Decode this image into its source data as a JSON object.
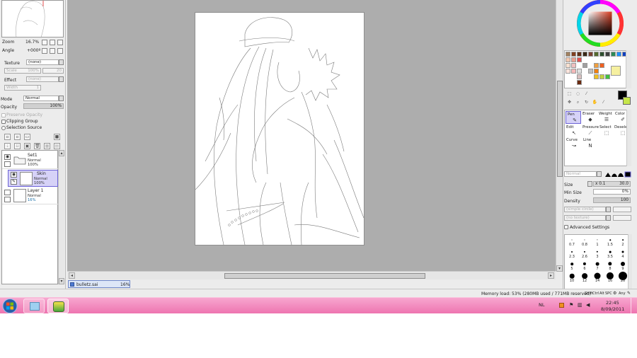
{
  "navigator": {
    "zoom_label": "Zoom",
    "zoom_value": "16.7%",
    "angle_label": "Angle",
    "angle_value": "+000º"
  },
  "texture": {
    "label": "Texture",
    "value": "(none)",
    "scale_label": "Scale",
    "scale_value": "100%",
    "strength_value": "20"
  },
  "effect": {
    "label": "Effect",
    "value": "(none)",
    "width_label": "Width",
    "width_value": "1"
  },
  "layer_props": {
    "mode_label": "Mode",
    "mode_value": "Normal",
    "opacity_label": "Opacity",
    "opacity_value": "100%",
    "preserve_opacity": "Preserve Opacity",
    "clipping_group": "Clipping Group",
    "selection_source": "Selection Source"
  },
  "layers": [
    {
      "name": "Set1",
      "mode": "Normal",
      "opacity": "100%",
      "type": "folder",
      "selected": false
    },
    {
      "name": "Skin",
      "mode": "Normal",
      "opacity": "100%",
      "type": "layer",
      "selected": true
    },
    {
      "name": "Layer 1",
      "mode": "Normal",
      "opacity": "16%",
      "type": "layer",
      "selected": false
    }
  ],
  "document_tab": {
    "name": "bulletz.sai",
    "zoom": "16%"
  },
  "tools": {
    "row1": [
      {
        "label": "Pen",
        "icon": "pen-icon",
        "selected": true
      },
      {
        "label": "Eraser",
        "icon": "eraser-icon",
        "selected": false
      },
      {
        "label": "Weight",
        "icon": "weight-icon",
        "selected": false
      },
      {
        "label": "Color",
        "icon": "color-tool-icon",
        "selected": false
      }
    ],
    "row2": [
      {
        "label": "Edit",
        "icon": "edit-icon"
      },
      {
        "label": "Pressure",
        "icon": "pressure-icon"
      },
      {
        "label": "Select",
        "icon": "select-icon"
      },
      {
        "label": "Deselect",
        "icon": "deselect-icon"
      }
    ],
    "row3": [
      {
        "label": "Curve",
        "icon": "curve-icon"
      },
      {
        "label": "Line",
        "icon": "line-icon"
      }
    ]
  },
  "brush": {
    "blend_mode": "Normal",
    "size_label": "Size",
    "size_multiplier": "x 0.1",
    "size_value": "30.0",
    "min_size_label": "Min Size",
    "min_size_value": "0%",
    "min_size_fraction": 0.0,
    "density_label": "Density",
    "density_value": "100",
    "density_fraction": 1.0,
    "shape": "(simple circle)",
    "texture": "(no texture)",
    "advanced": "Advanced Settings",
    "presets": [
      "0.7",
      "0.8",
      "1",
      "1.5",
      "2",
      "2.3",
      "2.6",
      "3",
      "3.5",
      "4",
      "5",
      "6",
      "7",
      "8",
      "9",
      "10",
      "12",
      "14",
      "16",
      "20"
    ]
  },
  "status": {
    "memory": "Memory load: 53% (280MB used / 771MB reserved)",
    "keys": [
      "Shift",
      "Ctrl",
      "Alt",
      "SPC",
      "Any"
    ]
  },
  "taskbar": {
    "language": "NL",
    "time": "22:45",
    "date": "8/09/2011"
  },
  "colors": {
    "selection_purple": "#6c63d6",
    "taskbar_pink": "#ee75b0",
    "primary_color": "#000000",
    "secondary_color": "#c6e64a"
  }
}
